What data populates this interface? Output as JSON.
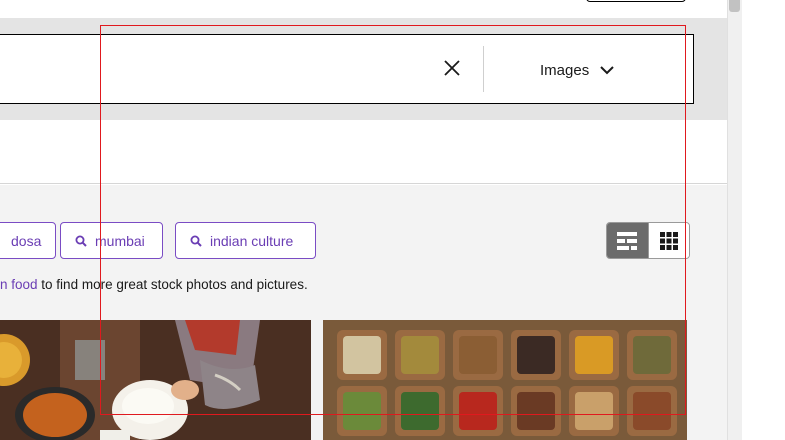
{
  "search": {
    "clear_icon": "close-icon",
    "type_label": "Images",
    "type_icon": "chevron-down-icon"
  },
  "related_searches": [
    {
      "label": "dosa",
      "icon": "search-icon"
    },
    {
      "label": "mumbai",
      "icon": "search-icon"
    },
    {
      "label": "indian culture",
      "icon": "search-icon"
    }
  ],
  "view_toggle": {
    "options": [
      "mosaic-view",
      "grid-view"
    ],
    "selected": "mosaic-view"
  },
  "hint": {
    "link_text": "n food",
    "rest_text": " to find more great stock photos and pictures."
  },
  "colors": {
    "accent": "#6a3db4",
    "highlight": "#e0191e",
    "search_band": "#e4e4e4",
    "content_bg": "#f3f3f3"
  }
}
